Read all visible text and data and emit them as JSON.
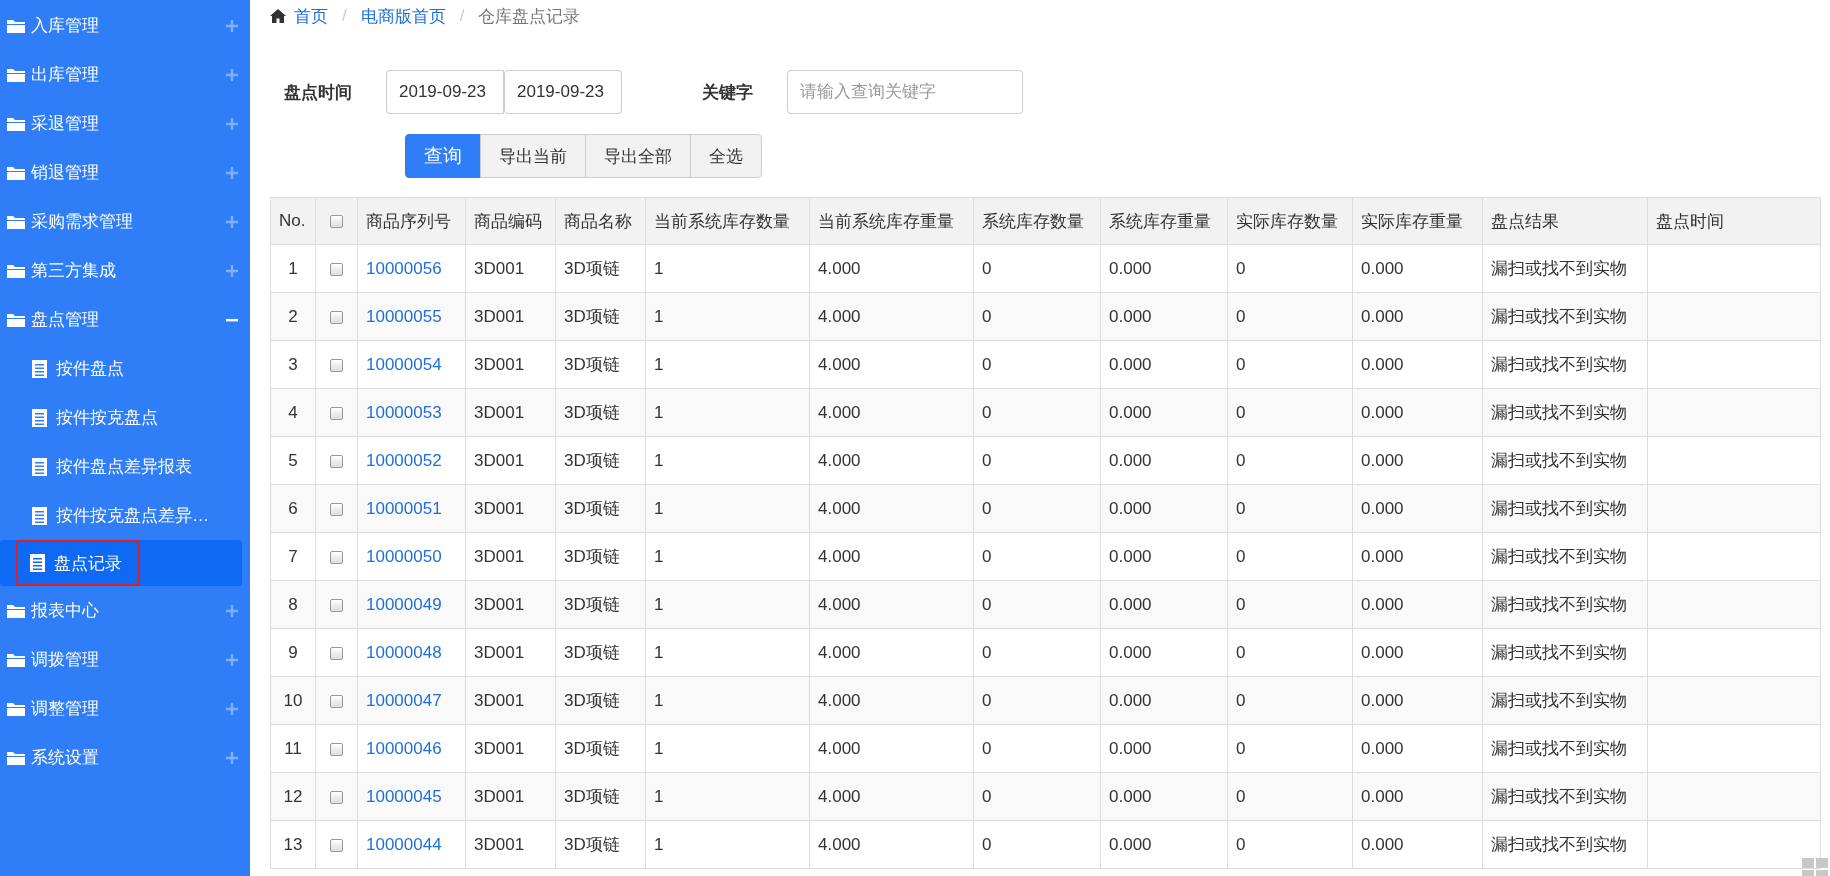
{
  "sidebar": {
    "items": [
      {
        "label": "入库管理",
        "expanded": false
      },
      {
        "label": "出库管理",
        "expanded": false
      },
      {
        "label": "采退管理",
        "expanded": false
      },
      {
        "label": "销退管理",
        "expanded": false
      },
      {
        "label": "采购需求管理",
        "expanded": false
      },
      {
        "label": "第三方集成",
        "expanded": false
      },
      {
        "label": "盘点管理",
        "expanded": true,
        "children": [
          {
            "label": "按件盘点",
            "selected": false
          },
          {
            "label": "按件按克盘点",
            "selected": false
          },
          {
            "label": "按件盘点差异报表",
            "selected": false
          },
          {
            "label": "按件按克盘点差异…",
            "selected": false
          },
          {
            "label": "盘点记录",
            "selected": true
          }
        ]
      },
      {
        "label": "报表中心",
        "expanded": false
      },
      {
        "label": "调拨管理",
        "expanded": false
      },
      {
        "label": "调整管理",
        "expanded": false
      },
      {
        "label": "系统设置",
        "expanded": false
      }
    ]
  },
  "breadcrumb": {
    "links": [
      "首页",
      "电商版首页"
    ],
    "separators": [
      "/",
      "/"
    ],
    "current": "仓库盘点记录"
  },
  "filters": {
    "time_label": "盘点时间",
    "date_from": "2019-09-23",
    "date_to": "2019-09-23",
    "keyword_label": "关键字",
    "keyword_placeholder": "请输入查询关键字"
  },
  "buttons": [
    {
      "label": "查询",
      "primary": true
    },
    {
      "label": "导出当前",
      "primary": false
    },
    {
      "label": "导出全部",
      "primary": false
    },
    {
      "label": "全选",
      "primary": false
    }
  ],
  "table": {
    "select_all_checked": false,
    "columns": [
      "No.",
      "",
      "商品序列号",
      "商品编码",
      "商品名称",
      "当前系统库存数量",
      "当前系统库存重量",
      "系统库存数量",
      "系统库存重量",
      "实际库存数量",
      "实际库存重量",
      "盘点结果",
      "盘点时间"
    ],
    "rows": [
      {
        "checked": false,
        "cells": [
          "1",
          "",
          "10000056",
          "3D001",
          "3D项链",
          "1",
          "4.000",
          "0",
          "0.000",
          "0",
          "0.000",
          "漏扫或找不到实物"
        ]
      },
      {
        "checked": false,
        "cells": [
          "2",
          "",
          "10000055",
          "3D001",
          "3D项链",
          "1",
          "4.000",
          "0",
          "0.000",
          "0",
          "0.000",
          "漏扫或找不到实物"
        ]
      },
      {
        "checked": false,
        "cells": [
          "3",
          "",
          "10000054",
          "3D001",
          "3D项链",
          "1",
          "4.000",
          "0",
          "0.000",
          "0",
          "0.000",
          "漏扫或找不到实物"
        ]
      },
      {
        "checked": false,
        "cells": [
          "4",
          "",
          "10000053",
          "3D001",
          "3D项链",
          "1",
          "4.000",
          "0",
          "0.000",
          "0",
          "0.000",
          "漏扫或找不到实物"
        ]
      },
      {
        "checked": false,
        "cells": [
          "5",
          "",
          "10000052",
          "3D001",
          "3D项链",
          "1",
          "4.000",
          "0",
          "0.000",
          "0",
          "0.000",
          "漏扫或找不到实物"
        ]
      },
      {
        "checked": false,
        "cells": [
          "6",
          "",
          "10000051",
          "3D001",
          "3D项链",
          "1",
          "4.000",
          "0",
          "0.000",
          "0",
          "0.000",
          "漏扫或找不到实物"
        ]
      },
      {
        "checked": false,
        "cells": [
          "7",
          "",
          "10000050",
          "3D001",
          "3D项链",
          "1",
          "4.000",
          "0",
          "0.000",
          "0",
          "0.000",
          "漏扫或找不到实物"
        ]
      },
      {
        "checked": false,
        "cells": [
          "8",
          "",
          "10000049",
          "3D001",
          "3D项链",
          "1",
          "4.000",
          "0",
          "0.000",
          "0",
          "0.000",
          "漏扫或找不到实物"
        ]
      },
      {
        "checked": false,
        "cells": [
          "9",
          "",
          "10000048",
          "3D001",
          "3D项链",
          "1",
          "4.000",
          "0",
          "0.000",
          "0",
          "0.000",
          "漏扫或找不到实物"
        ]
      },
      {
        "checked": false,
        "cells": [
          "10",
          "",
          "10000047",
          "3D001",
          "3D项链",
          "1",
          "4.000",
          "0",
          "0.000",
          "0",
          "0.000",
          "漏扫或找不到实物"
        ]
      },
      {
        "checked": false,
        "cells": [
          "11",
          "",
          "10000046",
          "3D001",
          "3D项链",
          "1",
          "4.000",
          "0",
          "0.000",
          "0",
          "0.000",
          "漏扫或找不到实物"
        ]
      },
      {
        "checked": false,
        "cells": [
          "12",
          "",
          "10000045",
          "3D001",
          "3D项链",
          "1",
          "4.000",
          "0",
          "0.000",
          "0",
          "0.000",
          "漏扫或找不到实物"
        ]
      },
      {
        "checked": false,
        "cells": [
          "13",
          "",
          "10000044",
          "3D001",
          "3D项链",
          "1",
          "4.000",
          "0",
          "0.000",
          "0",
          "0.000",
          "漏扫或找不到实物"
        ]
      }
    ]
  }
}
